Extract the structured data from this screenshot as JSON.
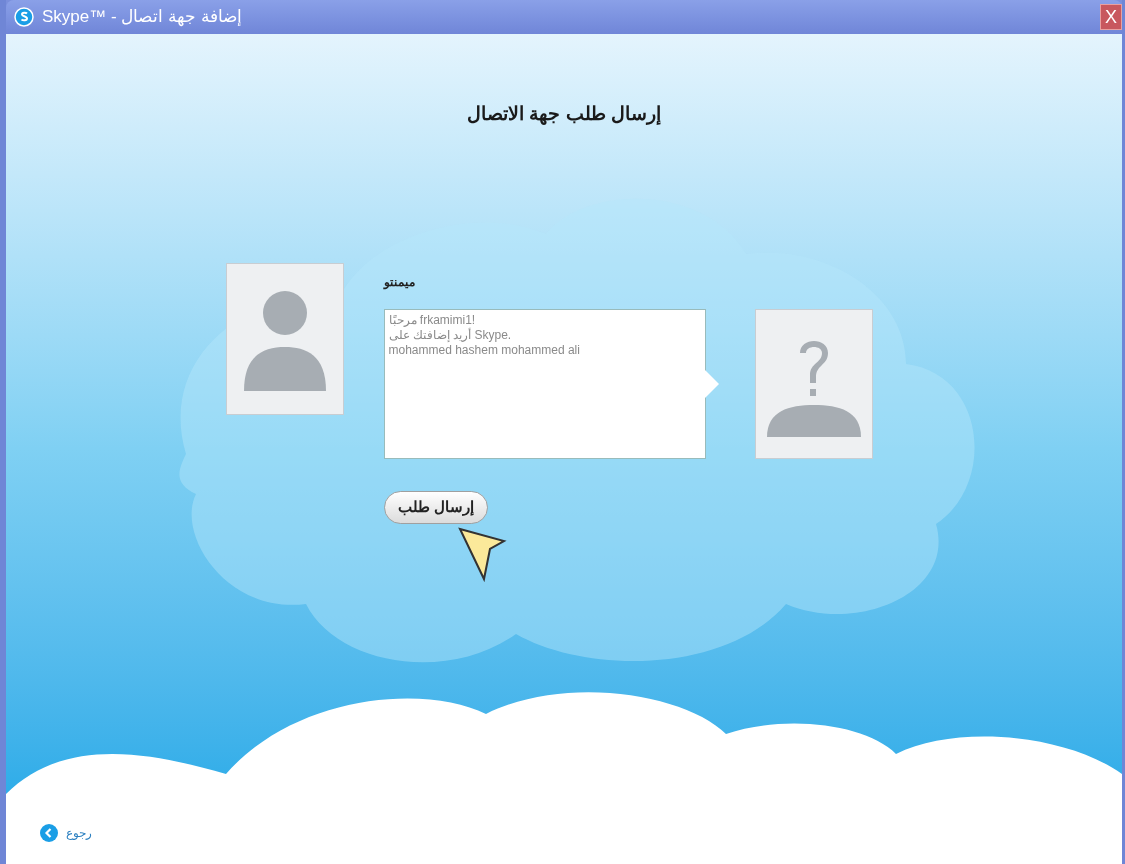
{
  "window": {
    "title": "Skype™ - إضافة جهة اتصال",
    "close": "X"
  },
  "heading": "إرسال طلب جهة الاتصال",
  "contact_name": "ميمنتو",
  "message": {
    "lines": [
      "مرحبًا frkamimi1!",
      "أريد إضافتك على Skype.",
      "mohammed hashem mohammed ali"
    ]
  },
  "send_button": "إرسال طلب",
  "back_link": "رجوع"
}
